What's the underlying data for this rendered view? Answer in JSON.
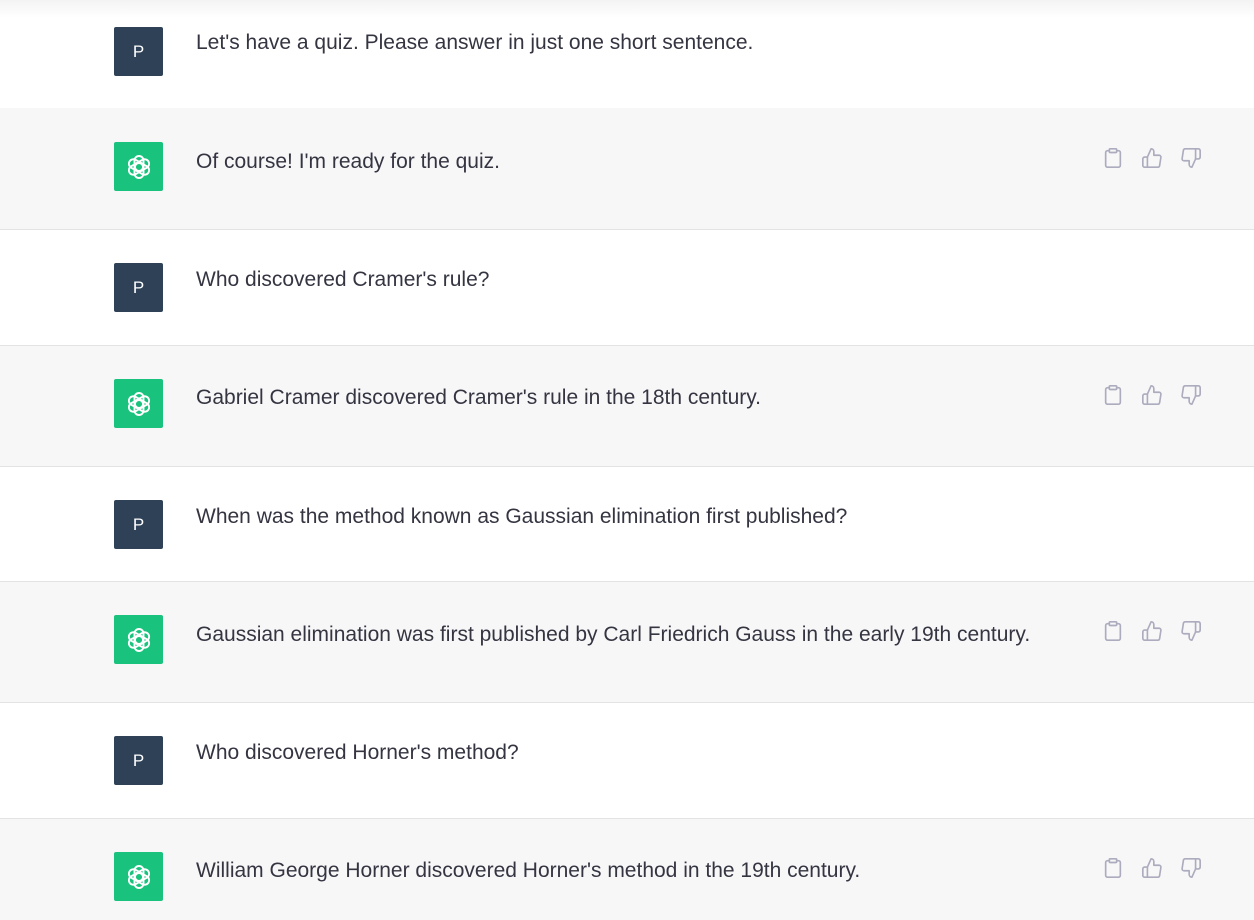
{
  "user_avatar_letter": "P",
  "colors": {
    "user_avatar_bg": "#2e4157",
    "assistant_avatar_bg": "#19c37d",
    "assistant_row_bg": "#f7f7f8",
    "text": "#343541",
    "action_icon": "#acacbe"
  },
  "messages": [
    {
      "role": "user",
      "text": "Let's have a quiz. Please answer in just one short sentence."
    },
    {
      "role": "assistant",
      "text": "Of course! I'm ready for the quiz.",
      "actions": [
        "clipboard-icon",
        "thumbs-up-icon",
        "thumbs-down-icon"
      ]
    },
    {
      "role": "user",
      "text": "Who discovered Cramer's rule?"
    },
    {
      "role": "assistant",
      "text": "Gabriel Cramer discovered Cramer's rule in the 18th century.",
      "actions": [
        "clipboard-icon",
        "thumbs-up-icon",
        "thumbs-down-icon"
      ]
    },
    {
      "role": "user",
      "text": "When was the method known as Gaussian elimination first published?"
    },
    {
      "role": "assistant",
      "text": "Gaussian elimination was first published by Carl Friedrich Gauss in the early 19th century.",
      "actions": [
        "clipboard-icon",
        "thumbs-up-icon",
        "thumbs-down-icon"
      ]
    },
    {
      "role": "user",
      "text": "Who discovered Horner's method?"
    },
    {
      "role": "assistant",
      "text": "William George Horner discovered Horner's method in the 19th century.",
      "actions": [
        "clipboard-icon",
        "thumbs-up-icon",
        "thumbs-down-icon"
      ]
    }
  ]
}
